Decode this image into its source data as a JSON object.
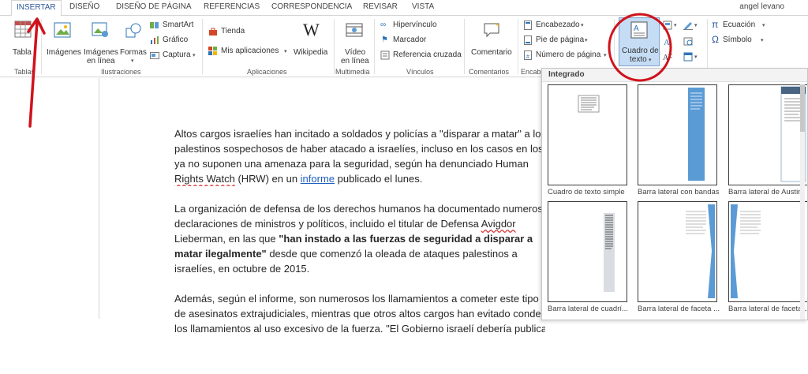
{
  "tabs": [
    {
      "label": "INSERTAR",
      "active": true
    },
    {
      "label": "DISEÑO"
    },
    {
      "label": "DISEÑO DE PÁGINA"
    },
    {
      "label": "REFERENCIAS"
    },
    {
      "label": "CORRESPONDENCIA"
    },
    {
      "label": "REVISAR"
    },
    {
      "label": "VISTA"
    }
  ],
  "user": "angel levano",
  "ribbon": {
    "tables": {
      "btn": "Tabla",
      "group": "Tablas"
    },
    "illustrations": {
      "imagenes": "Imágenes",
      "imagenes_line1": "Imágenes",
      "imagenes_line2": "en línea",
      "formas": "Formas",
      "smartart": "SmartArt",
      "grafico": "Gráfico",
      "captura": "Captura",
      "group": "Ilustraciones"
    },
    "apps": {
      "tienda": "Tienda",
      "mis_apps": "Mis aplicaciones",
      "wikipedia": "Wikipedia",
      "group": "Aplicaciones"
    },
    "media": {
      "line1": "Vídeo",
      "line2": "en línea",
      "group": "Multimedia"
    },
    "links": {
      "hipervinculo": "Hipervínculo",
      "marcador": "Marcador",
      "referencia": "Referencia cruzada",
      "group": "Vínculos"
    },
    "comments": {
      "comentario": "Comentario",
      "group": "Comentarios"
    },
    "header_footer": {
      "encabezado": "Encabezado",
      "pie": "Pie de página",
      "numero": "Número de página",
      "group": "Encab"
    },
    "text": {
      "cuadro_line1": "Cuadro de",
      "cuadro_line2": "texto"
    },
    "symbols": {
      "ecuacion": "Ecuación",
      "simbolo": "Símbolo"
    }
  },
  "document": {
    "p1": {
      "l1": "Altos cargos israelíes han incitado a soldados y policías a \"disparar a matar\" a los",
      "l2": "palestinos sospechosos de haber atacado a israelíes, incluso en los casos en los que",
      "l3": "ya no suponen una amenaza para la seguridad, según ha denunciado Human",
      "l4a": "Rights Watch",
      "l4b": " (HRW) en un ",
      "l4link": "informe",
      "l4c": " publicado el lunes."
    },
    "p2": {
      "l1": "La organización de defensa de los derechos humanos ha documentado numerosas",
      "l2a": "declaraciones de ministros y políticos, incluido el titular de Defensa ",
      "l2b": "Avigdor",
      "l3a": "Lieberman, en las que ",
      "l3b": "\"han instado a las fuerzas de seguridad a disparar a",
      "l4a": "matar ilegalmente\"",
      "l4b": " desde que comenzó la oleada de ataques palestinos a",
      "l5": "israelíes, en octubre de 2015."
    },
    "p3": {
      "l1": "Además, según  el informe, son numerosos los llamamientos a cometer este tipo",
      "l2": "de asesinatos extrajudiciales, mientras que otros altos cargos han evitado condenar",
      "l3": "los llamamientos al uso excesivo de la fuerza. \"El Gobierno israelí debería publicar"
    }
  },
  "gallery": {
    "header": "Integrado",
    "items": [
      "Cuadro de texto simple",
      "Barra lateral con bandas",
      "Barra lateral de Austin",
      "Barra lateral de cuadrí...",
      "Barra lateral de faceta ...",
      "Barra lateral de faceta ..."
    ]
  },
  "colors": {
    "accent": "#2b579a",
    "annotation": "#d0121b",
    "sidebar_blue": "#5b9bd5"
  }
}
